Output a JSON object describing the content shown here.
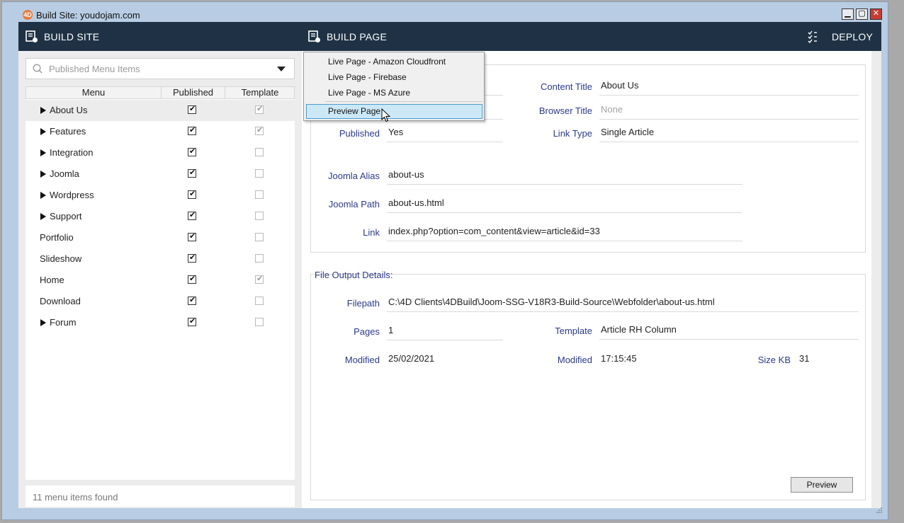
{
  "window": {
    "title": "Build Site: youdojam.com",
    "app_icon_glyph": "4D",
    "controls": {
      "minimize": "▁",
      "maximize": "▢",
      "close": "✕"
    }
  },
  "toolbar": {
    "build_site": "BUILD SITE",
    "build_page": "BUILD PAGE",
    "deploy": "DEPLOY",
    "background": "#1f3245"
  },
  "search": {
    "placeholder": "Published Menu Items",
    "value": ""
  },
  "table": {
    "headers": {
      "menu": "Menu",
      "published": "Published",
      "template": "Template"
    },
    "rows": [
      {
        "label": "About Us",
        "expandable": true,
        "published": true,
        "template": true,
        "selected": true
      },
      {
        "label": "Features",
        "expandable": true,
        "published": true,
        "template": true
      },
      {
        "label": "Integration",
        "expandable": true,
        "published": true,
        "template": false
      },
      {
        "label": "Joomla",
        "expandable": true,
        "published": true,
        "template": false
      },
      {
        "label": "Wordpress",
        "expandable": true,
        "published": true,
        "template": false
      },
      {
        "label": "Support",
        "expandable": true,
        "published": true,
        "template": false
      },
      {
        "label": "Portfolio",
        "expandable": false,
        "published": true,
        "template": false
      },
      {
        "label": "Slideshow",
        "expandable": false,
        "published": true,
        "template": false
      },
      {
        "label": "Home",
        "expandable": false,
        "published": true,
        "template": true
      },
      {
        "label": "Download",
        "expandable": false,
        "published": true,
        "template": false
      },
      {
        "label": "Forum",
        "expandable": true,
        "published": true,
        "template": false
      }
    ]
  },
  "status": {
    "text": "11 menu items found"
  },
  "details": {
    "content_title_label": "Content Title",
    "content_title": "About Us",
    "browser_title_label": "Browser Title",
    "browser_title_placeholder": "None",
    "published_label": "Published",
    "published": "Yes",
    "link_type_label": "Link Type",
    "link_type": "Single Article",
    "joomla_alias_label": "Joomla Alias",
    "joomla_alias": "about-us",
    "joomla_path_label": "Joomla Path",
    "joomla_path": "about-us.html",
    "link_label": "Link",
    "link": "index.php?option=com_content&view=article&id=33"
  },
  "output": {
    "title": "File Output Details:",
    "filepath_label": "Filepath",
    "filepath": "C:\\4D Clients\\4DBuild\\Joom-SSG-V18R3-Build-Source\\Webfolder\\about-us.html",
    "pages_label": "Pages",
    "pages": "1",
    "template_label": "Template",
    "template": "Article RH Column",
    "modified_date_label": "Modified",
    "modified_date": "25/02/2021",
    "modified_time_label": "Modified",
    "modified_time": "17:15:45",
    "size_label": "Size KB",
    "size": "31",
    "preview_button": "Preview"
  },
  "build_page_menu": {
    "items": [
      "Live Page - Amazon Cloudfront",
      "Live Page - Firebase",
      "Live Page - MS Azure",
      "Preview Page"
    ],
    "hovered": "Preview Page"
  },
  "icons": {
    "build_site": "build-site-icon",
    "build_page": "build-page-icon",
    "deploy": "deploy-checklist-icon",
    "search": "search-icon",
    "dropdown": "chevron-down-icon"
  }
}
